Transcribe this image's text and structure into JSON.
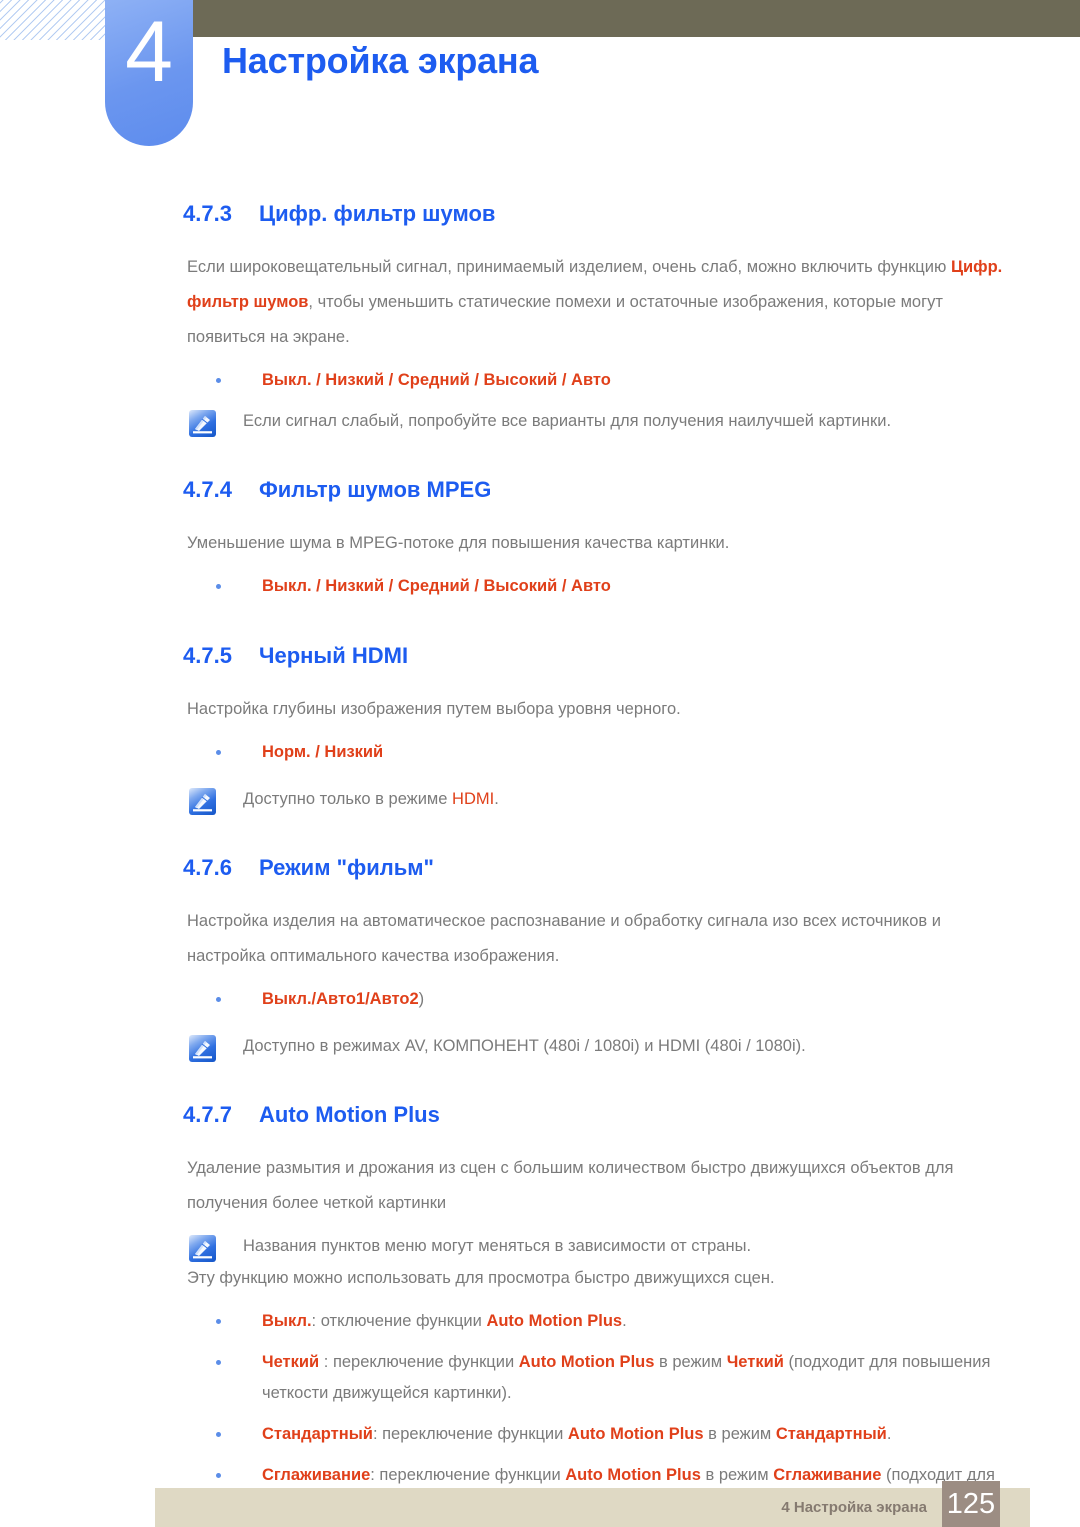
{
  "header": {
    "chapter_number": "4",
    "chapter_title": "Настройка экрана"
  },
  "sections": [
    {
      "number": "4.7.3",
      "title": "Цифр. фильтр шумов",
      "paragraph_a": "Если широковещательный сигнал, принимаемый изделием, очень слаб, можно включить функцию ",
      "paragraph_a_hl": "Цифр. фильтр шумов",
      "paragraph_b": ", чтобы уменьшить статические помехи и остаточные изображения, которые могут появиться на экране.",
      "options": "Выкл. / Низкий / Средний / Высокий / Авто",
      "note": "Если сигнал слабый, попробуйте все варианты для получения наилучшей картинки."
    },
    {
      "number": "4.7.4",
      "title": "Фильтр шумов MPEG",
      "paragraph": "Уменьшение шума в MPEG-потоке для повышения качества картинки.",
      "options": "Выкл. / Низкий / Средний / Высокий / Авто"
    },
    {
      "number": "4.7.5",
      "title": "Черный HDMI",
      "paragraph": "Настройка глубины изображения путем выбора уровня черного.",
      "options": "Норм. / Низкий",
      "note_pre": "Доступно только в режиме ",
      "note_hl": "HDMI",
      "note_post": "."
    },
    {
      "number": "4.7.6",
      "title": "Режим \"фильм\"",
      "paragraph": "Настройка изделия на автоматическое распознавание и обработку сигнала изо всех источников и настройка оптимального качества изображения.",
      "options": "Выкл./Авто1/Авто2",
      "options_tail": ")",
      "note": "Доступно в режимах AV, КОМПОНЕНТ (480i / 1080i) и HDMI (480i / 1080i)."
    },
    {
      "number": "4.7.7",
      "title": "Auto Motion Plus",
      "paragraph": "Удаление размытия и дрожания из сцен с большим количеством быстро движущихся объектов для получения более четкой картинки",
      "note": "Названия пунктов меню могут меняться в зависимости от страны.",
      "paragraph2": "Эту функцию можно использовать для просмотра быстро движущихся сцен.",
      "items": [
        {
          "term": "Выкл.",
          "mid": ": отключение функции ",
          "feature": "Auto Motion Plus",
          "tail": "."
        },
        {
          "term": "Четкий",
          "mid": " : переключение функции ",
          "feature": "Auto Motion Plus",
          "mid2": " в режим ",
          "mode": "Четкий",
          "tail": " (подходит для повышения четкости движущейся картинки)."
        },
        {
          "term": "Стандартный",
          "mid": ": переключение функции ",
          "feature": "Auto Motion Plus",
          "mid2": " в режим ",
          "mode": "Стандартный",
          "tail": "."
        },
        {
          "term": "Сглаживание",
          "mid": ": переключение функции ",
          "feature": "Auto Motion Plus",
          "mid2": " в режим ",
          "mode": "Сглаживание",
          "tail": " (подходит для повышения плавности движущейся картинки)."
        }
      ]
    }
  ],
  "footer": {
    "label": "4 Настройка экрана",
    "page_number": "125"
  },
  "icons": {
    "note": "note-pen-icon"
  },
  "colors": {
    "heading_blue": "#1d5cf0",
    "highlight_orange": "#e0401a",
    "body_gray": "#7b7b7b",
    "chapter_bar": "#6d6a56",
    "footer_bar": "#dfd9c4",
    "footer_page_box": "#9c8d83"
  }
}
